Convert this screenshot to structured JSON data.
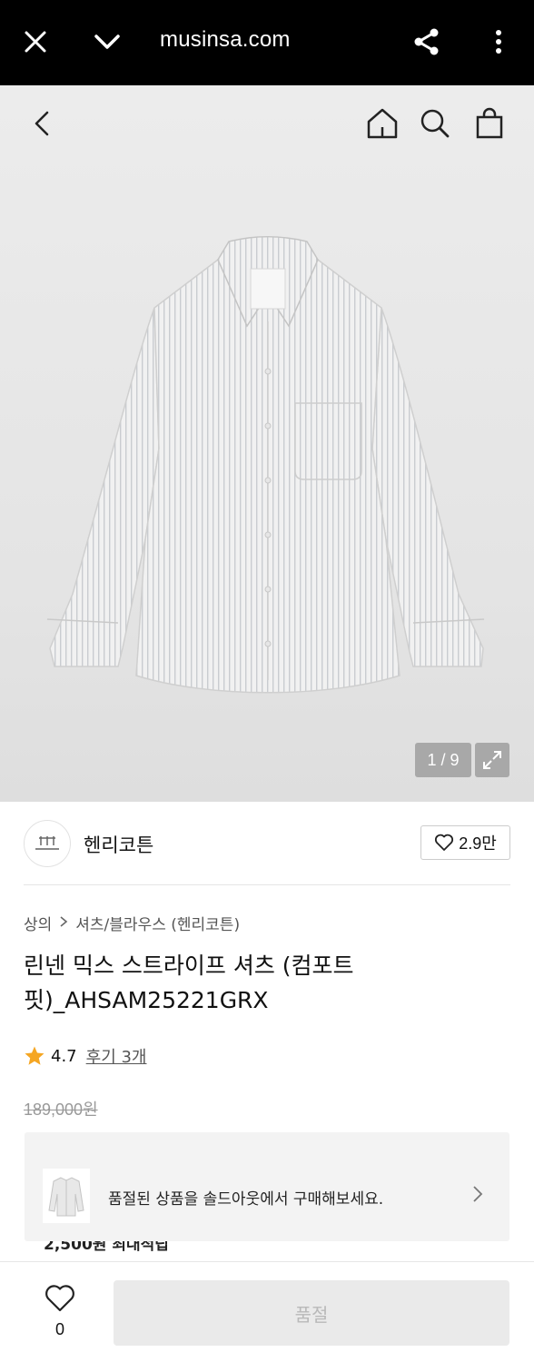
{
  "browser": {
    "url": "musinsa.com",
    "icons": [
      "close-icon",
      "chevron-down-icon",
      "share-icon",
      "more-vertical-icon"
    ]
  },
  "gallery": {
    "counter": "1 / 9",
    "icons": [
      "back-icon",
      "home-icon",
      "search-icon",
      "bag-icon",
      "expand-icon"
    ]
  },
  "brand": {
    "name": "헨리코튼",
    "likes": "2.9만"
  },
  "breadcrumb": {
    "category": "상의",
    "subcategory": "셔츠/블라우스 (헨리코튼)"
  },
  "product": {
    "title": "린넨 믹스 스트라이프 셔츠 (컴포트핏)_AHSAM25221GRX",
    "rating": "4.7",
    "reviews": "후기 3개",
    "original_price": "189,000원"
  },
  "soldout_banner": {
    "message": "품절된 상품을 솔드아웃에서 구매해보세요."
  },
  "partial_text": "2,500원 최대적립",
  "bottom_bar": {
    "wish_count": "0",
    "buy_label": "품절"
  },
  "colors": {
    "star": "#f5a623",
    "soldout_bg": "#f3f3f3",
    "disabled_btn": "#eaeaea"
  }
}
